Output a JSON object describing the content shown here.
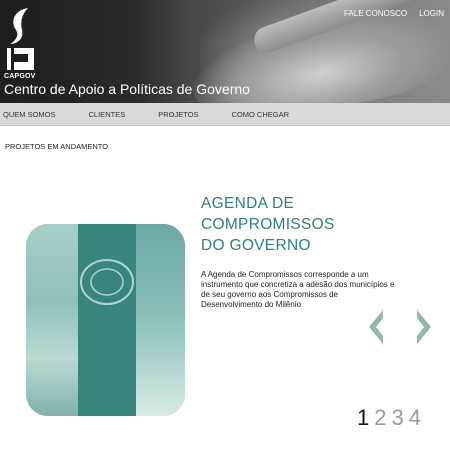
{
  "header": {
    "logo_caption": "CAPGOV",
    "site_title": "Centro de Apoio a Políticas de Governo",
    "top_links": [
      "FALE CONOSCO",
      "LOGIN"
    ]
  },
  "nav": {
    "items": [
      "QUEM SOMOS",
      "CLIENTES",
      "PROJETOS",
      "COMO CHEGAR"
    ]
  },
  "main": {
    "section_heading": "PROJETOS EM ANDAMENTO",
    "project": {
      "title_line1": "AGENDA DE COMPROMISSOS",
      "title_line2": "DO GOVERNO",
      "description": "A Agenda de Compromissos corresponde a um instrumento que concretiza a adesão dos municípios e de seu governo aos Compromissos de Desenvolvimento do Milênio"
    },
    "pager": {
      "pages": [
        "1",
        "2",
        "3",
        "4"
      ],
      "active_page": "1"
    }
  },
  "colors": {
    "accent": "#2f7f77",
    "arrow": "#8fb8b3",
    "nav_bg": "#d9d9d9"
  },
  "icons": {
    "prev": "chevron-left-icon",
    "next": "chevron-right-icon",
    "logo": "capgov-logo-icon"
  }
}
